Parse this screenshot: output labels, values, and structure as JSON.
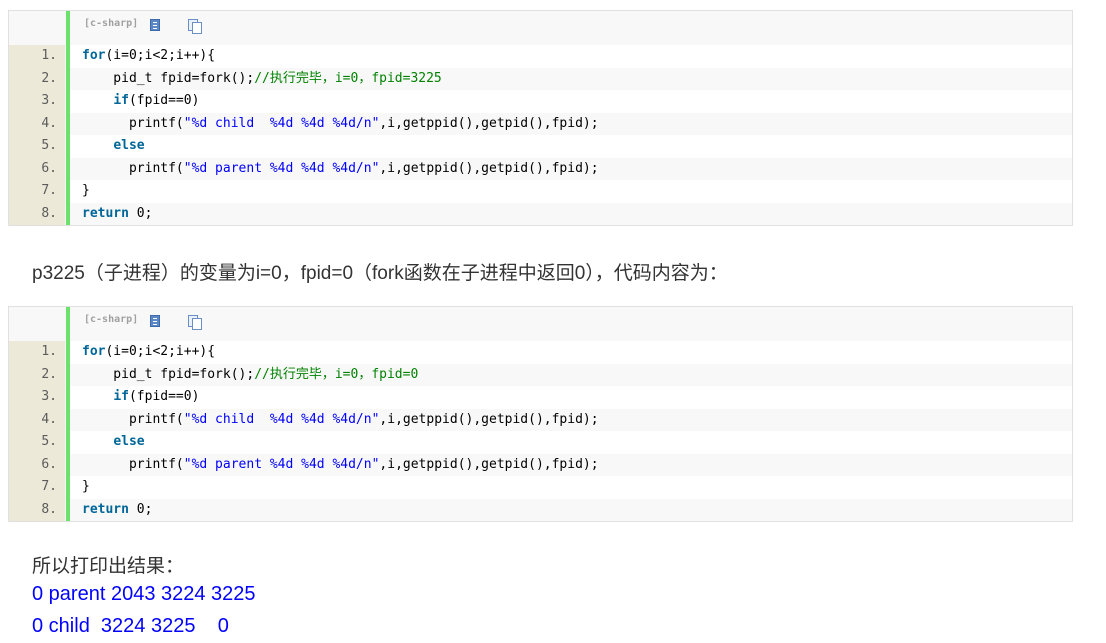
{
  "code_blocks": [
    {
      "lang_label": "[c-sharp]",
      "lines": [
        [
          {
            "t": "for",
            "c": "kw"
          },
          {
            "t": "(i=0;i<2;i++){",
            "c": ""
          }
        ],
        [
          {
            "t": "    pid_t fpid=fork();",
            "c": ""
          },
          {
            "t": "//执行完毕，i=0，fpid=3225",
            "c": "cmt"
          }
        ],
        [
          {
            "t": "    ",
            "c": ""
          },
          {
            "t": "if",
            "c": "kw"
          },
          {
            "t": "(fpid==0)",
            "c": ""
          }
        ],
        [
          {
            "t": "      printf(",
            "c": ""
          },
          {
            "t": "\"%d child  %4d %4d %4d/n\"",
            "c": "str"
          },
          {
            "t": ",i,getppid(),getpid(),fpid);",
            "c": ""
          }
        ],
        [
          {
            "t": "    ",
            "c": ""
          },
          {
            "t": "else",
            "c": "kw"
          }
        ],
        [
          {
            "t": "      printf(",
            "c": ""
          },
          {
            "t": "\"%d parent %4d %4d %4d/n\"",
            "c": "str"
          },
          {
            "t": ",i,getppid(),getpid(),fpid);",
            "c": ""
          }
        ],
        [
          {
            "t": "}",
            "c": ""
          }
        ],
        [
          {
            "t": "return",
            "c": "kw"
          },
          {
            "t": " 0;",
            "c": ""
          }
        ]
      ]
    },
    {
      "lang_label": "[c-sharp]",
      "lines": [
        [
          {
            "t": "for",
            "c": "kw"
          },
          {
            "t": "(i=0;i<2;i++){",
            "c": ""
          }
        ],
        [
          {
            "t": "    pid_t fpid=fork();",
            "c": ""
          },
          {
            "t": "//执行完毕，i=0，fpid=0",
            "c": "cmt"
          }
        ],
        [
          {
            "t": "    ",
            "c": ""
          },
          {
            "t": "if",
            "c": "kw"
          },
          {
            "t": "(fpid==0)",
            "c": ""
          }
        ],
        [
          {
            "t": "      printf(",
            "c": ""
          },
          {
            "t": "\"%d child  %4d %4d %4d/n\"",
            "c": "str"
          },
          {
            "t": ",i,getppid(),getpid(),fpid);",
            "c": ""
          }
        ],
        [
          {
            "t": "    ",
            "c": ""
          },
          {
            "t": "else",
            "c": "kw"
          }
        ],
        [
          {
            "t": "      printf(",
            "c": ""
          },
          {
            "t": "\"%d parent %4d %4d %4d/n\"",
            "c": "str"
          },
          {
            "t": ",i,getppid(),getpid(),fpid);",
            "c": ""
          }
        ],
        [
          {
            "t": "}",
            "c": ""
          }
        ],
        [
          {
            "t": "return",
            "c": "kw"
          },
          {
            "t": " 0;",
            "c": ""
          }
        ]
      ]
    }
  ],
  "line_numbers": [
    "1.",
    "2.",
    "3.",
    "4.",
    "5.",
    "6.",
    "7.",
    "8."
  ],
  "paragraph_1": "p3225（子进程）的变量为i=0，fpid=0（fork函数在子进程中返回0），代码内容为：",
  "paragraph_2": "所以打印出结果：",
  "result_lines": [
    "0 parent 2043 3224 3225",
    "0 child  3224 3225    0"
  ],
  "colors": {
    "gutter_bar": "#6ce26c",
    "keyword": "#006699",
    "string": "#0000ff",
    "comment": "#008200",
    "result": "#0000ff"
  },
  "icons": [
    "view-source-icon",
    "copy-to-clipboard-icon"
  ]
}
